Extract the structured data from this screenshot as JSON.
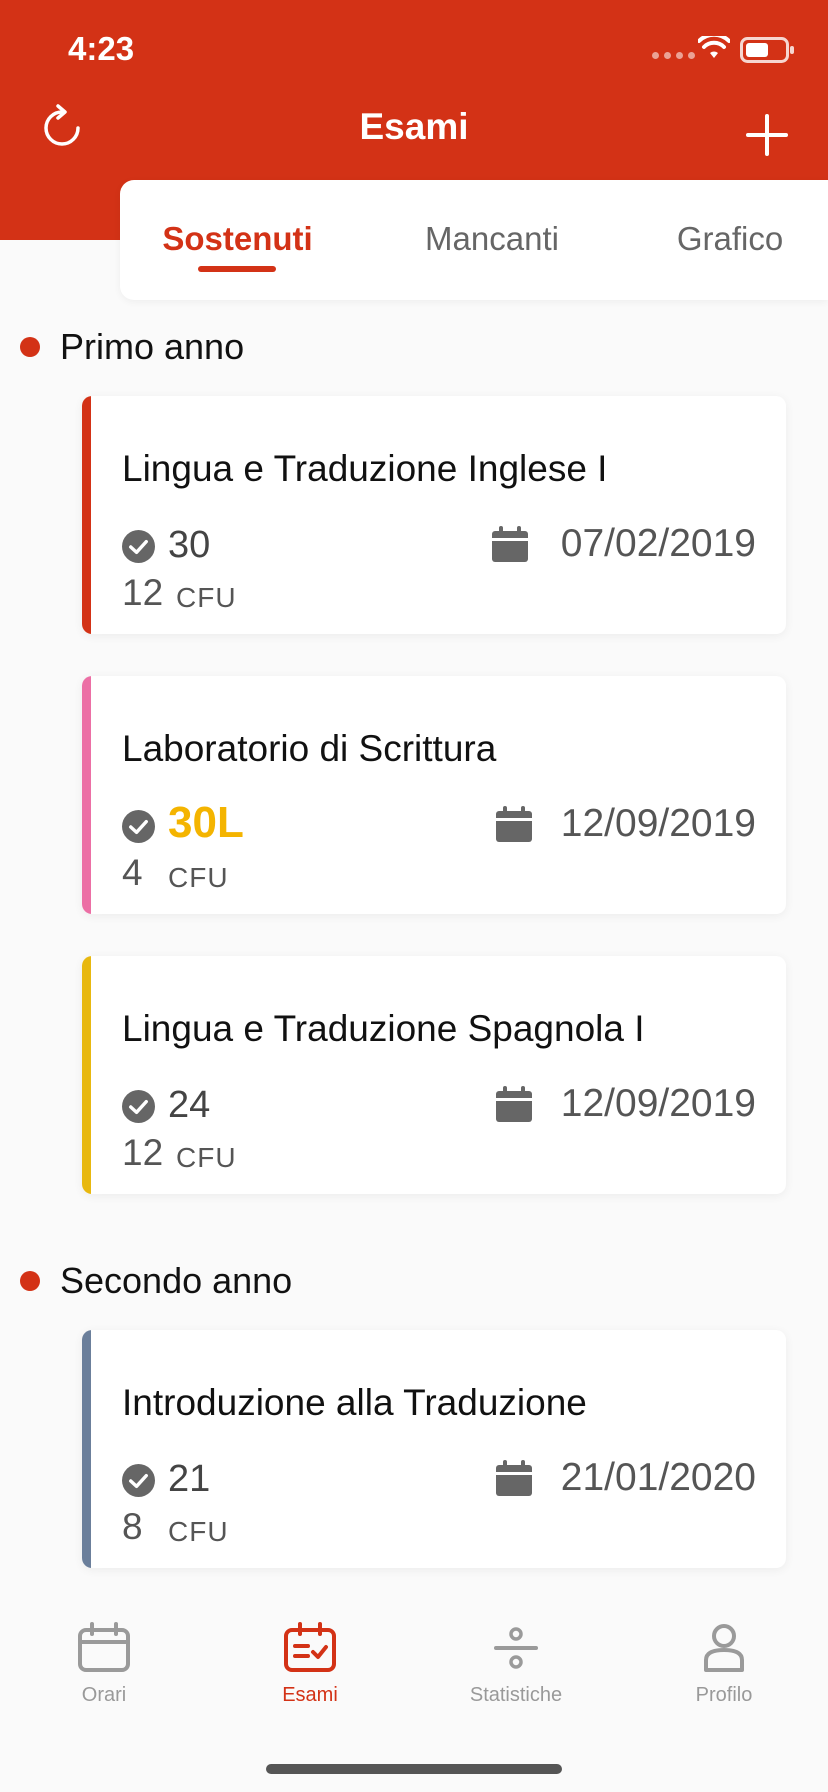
{
  "status_bar": {
    "time": "4:23"
  },
  "header": {
    "title": "Esami",
    "refresh_icon": "refresh-icon",
    "add_icon": "plus-icon"
  },
  "tabs": [
    {
      "label": "Sostenuti",
      "active": true
    },
    {
      "label": "Mancanti",
      "active": false
    },
    {
      "label": "Grafico",
      "active": false
    }
  ],
  "sections": [
    {
      "title": "Primo anno",
      "exams": [
        {
          "name": "Lingua e Traduzione Inglese I",
          "grade": "30",
          "cfu": "12",
          "cfu_label": "CFU",
          "date": "07/02/2019",
          "color": "#d33216"
        },
        {
          "name": "Laboratorio di Scrittura",
          "grade": "30L",
          "cfu": "4",
          "cfu_label": "CFU",
          "date": "12/09/2019",
          "color": "#ec6fa5"
        },
        {
          "name": "Lingua e Traduzione Spagnola I",
          "grade": "24",
          "cfu": "12",
          "cfu_label": "CFU",
          "date": "12/09/2019",
          "color": "#e8b80f"
        }
      ]
    },
    {
      "title": "Secondo anno",
      "exams": [
        {
          "name": "Introduzione alla Traduzione",
          "grade": "21",
          "cfu": "8",
          "cfu_label": "CFU",
          "date": "21/01/2020",
          "color": "#6b7f9b"
        }
      ]
    }
  ],
  "bottom_nav": [
    {
      "label": "Orari",
      "icon": "calendar-icon",
      "active": false
    },
    {
      "label": "Esami",
      "icon": "exam-icon",
      "active": true
    },
    {
      "label": "Statistiche",
      "icon": "divide-icon",
      "active": false
    },
    {
      "label": "Profilo",
      "icon": "profile-icon",
      "active": false
    }
  ],
  "colors": {
    "accent": "#d33216",
    "laude": "#f4b400"
  }
}
